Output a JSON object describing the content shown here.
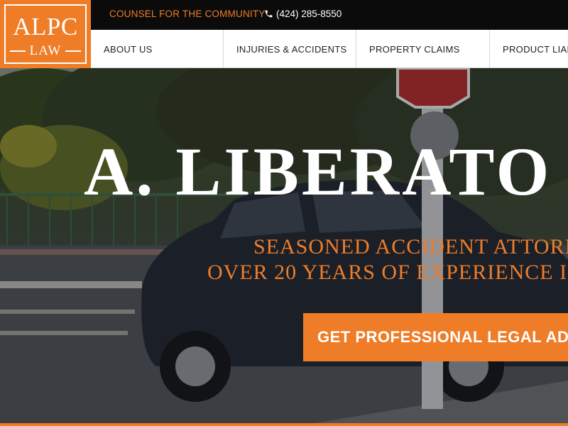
{
  "header": {
    "tagline": "COUNSEL FOR THE COMMUNITY",
    "phone": "(424) 285-8550",
    "phone_icon": "phone-icon"
  },
  "logo": {
    "line1": "ALPC",
    "line2": "LAW"
  },
  "nav": {
    "items": [
      {
        "label": "ABOUT US"
      },
      {
        "label": "INJURIES & ACCIDENTS"
      },
      {
        "label": "PROPERTY CLAIMS"
      },
      {
        "label": "PRODUCT LIAB"
      }
    ]
  },
  "hero": {
    "title": "A. LIBERATO",
    "subtitle_line1": "SEASONED ACCIDENT ATTORN",
    "subtitle_line2": "OVER 20 YEARS OF EXPERIENCE IN",
    "cta_label": "GET PROFESSIONAL LEGAL AD"
  },
  "colors": {
    "accent": "#ef7d28",
    "topbar": "#0b0b0b",
    "nav_bg": "#ffffff",
    "hero_text": "#ffffff"
  }
}
